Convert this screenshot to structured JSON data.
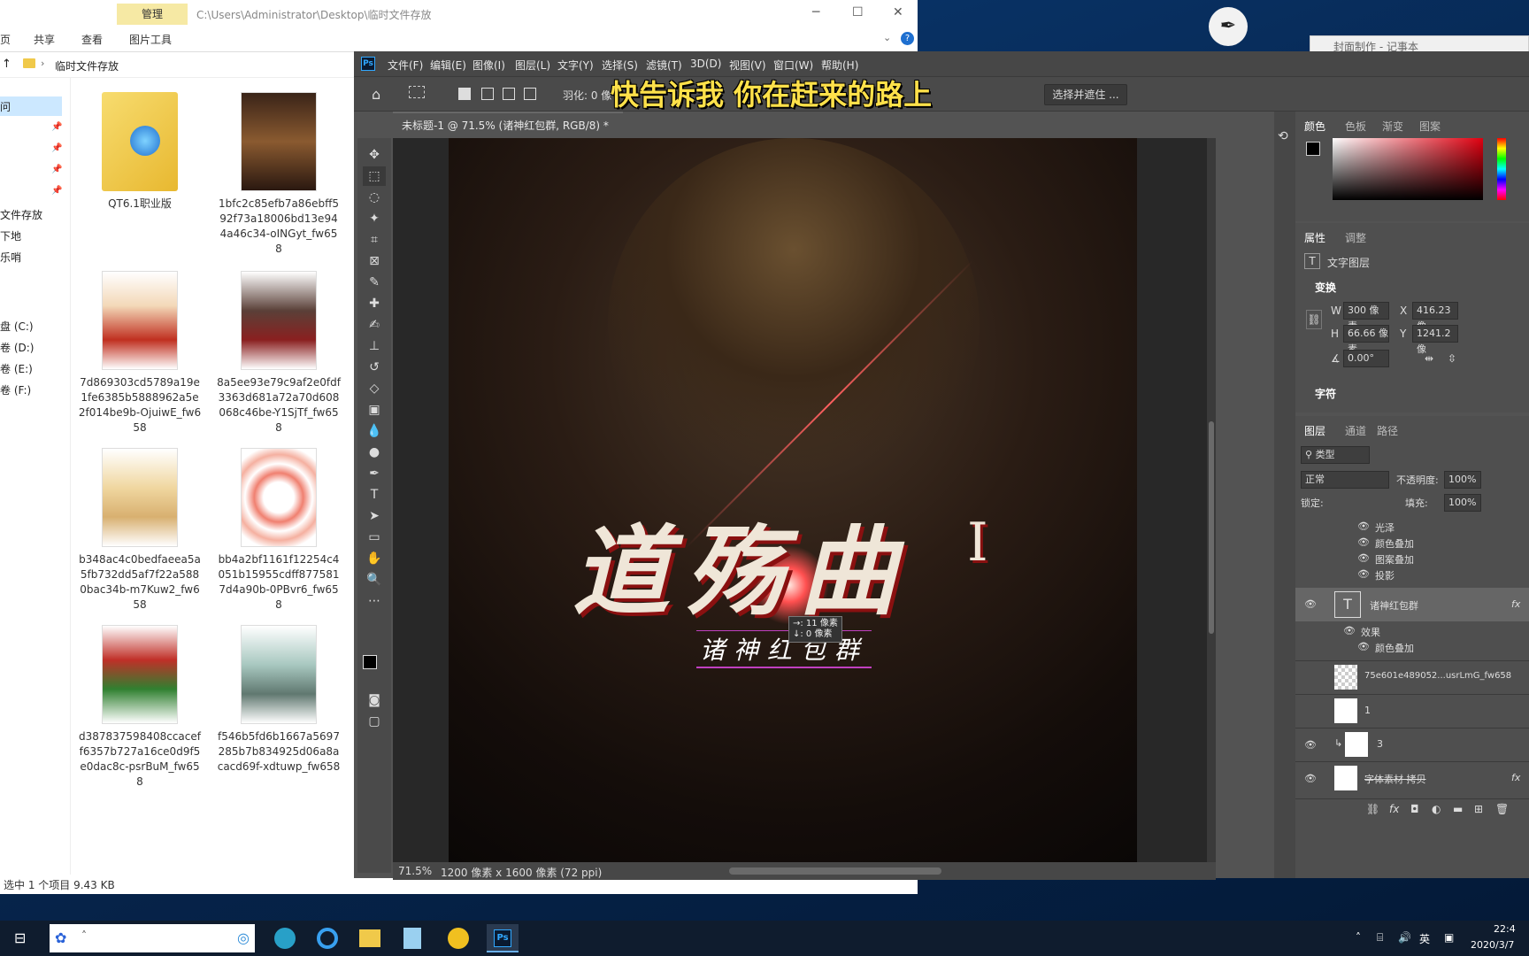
{
  "explorer": {
    "manage_tab": "管理",
    "path_title": "C:\\Users\\Administrator\\Desktop\\临时文件存放",
    "ribbon_tabs": [
      "页",
      "共享",
      "查看",
      "图片工具"
    ],
    "breadcrumb": "临时文件存放",
    "nav_items": [
      "问",
      "文件存放",
      "下地",
      "乐哨",
      "盘 (C:)",
      "卷 (D:)",
      "卷 (E:)",
      "卷 (F:)"
    ],
    "files": [
      {
        "name": "QT6.1职业版",
        "icon": "folder-icon"
      },
      {
        "name": "1bfc2c85efb7a86ebff592f73a18006bd13e944a46c34-oINGyt_fw658",
        "icon": "image-thumb"
      },
      {
        "name": "7d869303cd5789a19e1fe6385b5888962a5e2f014be9b-OjuiwE_fw658",
        "icon": "image-thumb"
      },
      {
        "name": "8a5ee93e79c9af2e0fdf3363d681a72a70d608068c46be-Y1SjTf_fw658",
        "icon": "image-thumb"
      },
      {
        "name": "b348ac4c0bedfaeea5a5fb732dd5af7f22a5880bac34b-m7Kuw2_fw658",
        "icon": "image-thumb"
      },
      {
        "name": "bb4a2bf1161f12254c4051b15955cdff8775817d4a90b-0PBvr6_fw658",
        "icon": "image-thumb"
      },
      {
        "name": "d387837598408ccaceff6357b727a16ce0d9f5e0dac8c-psrBuM_fw658",
        "icon": "image-thumb"
      },
      {
        "name": "f546b5fd6b1667a5697285b7b834925d06a8acacd69f-xdtuwp_fw658",
        "icon": "image-thumb"
      }
    ],
    "status": "选中 1 个项目  9.43 KB"
  },
  "notepad_title": "封面制作 - 记事本",
  "photoshop": {
    "menu": [
      "文件(F)",
      "编辑(E)",
      "图像(I)",
      "图层(L)",
      "文字(Y)",
      "选择(S)",
      "滤镜(T)",
      "3D(D)",
      "视图(V)",
      "窗口(W)",
      "帮助(H)"
    ],
    "options": {
      "feather_label": "羽化: 0 像",
      "select_mask_button": "选择并遮住 ..."
    },
    "doc_tab": "未标题-1 @ 71.5% (诸神红包群, RGB/8) *",
    "zoom": "71.5%",
    "doc_info": "1200 像素 x 1600 像素 (72 ppi)",
    "art": {
      "title": "道殇曲",
      "roman": "I",
      "subtitle_art": "诸神红包群",
      "tooltip_line1": "→: 11 像素",
      "tooltip_line2": "↓: 0 像素"
    },
    "subtitle_overlay": "快告诉我 你在赶来的路上",
    "color_tabs": [
      "颜色",
      "色板",
      "渐变",
      "图案"
    ],
    "props_tabs": [
      "属性",
      "调整"
    ],
    "layer_type": "文字图层",
    "transform_label": "变换",
    "w_label": "W",
    "w_value": "300 像素",
    "x_label": "X",
    "x_value": "416.23 像",
    "h_label": "H",
    "h_value": "66.66 像素",
    "y_label": "Y",
    "y_value": "1241.2 像",
    "angle_value": "0.00°",
    "char_label": "字符",
    "layers_tabs": [
      "图层",
      "通道",
      "路径"
    ],
    "filter_kind": "类型",
    "blend_mode": "正常",
    "opacity_label": "不透明度:",
    "opacity_value": "100%",
    "lock_label": "锁定:",
    "fill_label": "填充:",
    "fill_value": "100%",
    "effects_top": [
      "光泽",
      "颜色叠加",
      "图案叠加",
      "投影"
    ],
    "layers": [
      {
        "name": "诸神红包群",
        "fx": "fx",
        "effects_label": "效果",
        "effect": "颜色叠加"
      },
      {
        "name": "75e601e489052...usrLmG_fw658"
      },
      {
        "name": "1"
      },
      {
        "name": "3"
      },
      {
        "name": "字体素材 拷贝",
        "fx": "fx"
      }
    ]
  },
  "taskbar": {
    "time": "22:4",
    "date": "2020/3/7",
    "ime": "英"
  }
}
